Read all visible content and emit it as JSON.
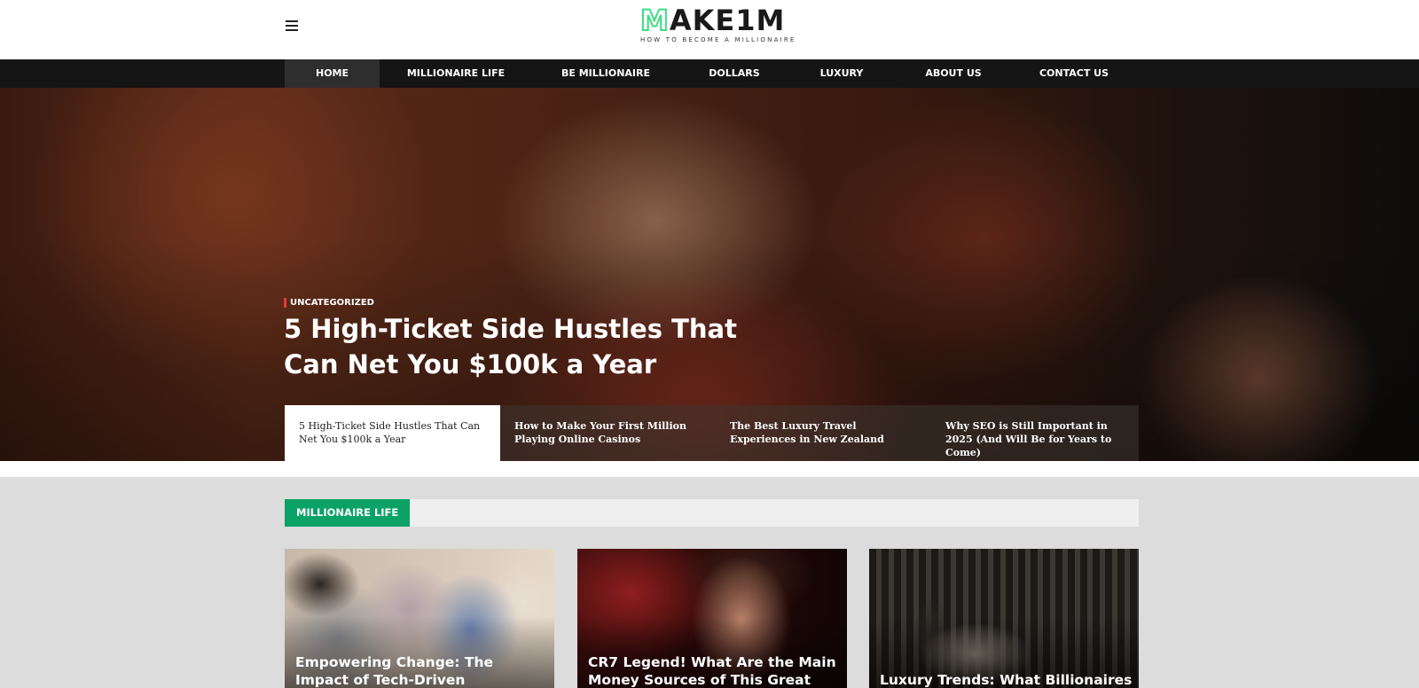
{
  "logo": {
    "m_letter": "M",
    "rest": "AKE1M",
    "tagline": "HOW TO BECOME A MILLIONAIRE"
  },
  "nav": {
    "items": [
      {
        "label": "HOME",
        "active": true
      },
      {
        "label": "MILLIONAIRE LIFE"
      },
      {
        "label": "BE MILLIONAIRE"
      },
      {
        "label": "DOLLARS"
      },
      {
        "label": "LUXURY"
      },
      {
        "label": "ABOUT US"
      },
      {
        "label": "CONTACT US"
      }
    ]
  },
  "hero": {
    "category": "UNCATEGORIZED",
    "title": "5 High-Ticket Side Hustles That Can Net You $100k a Year",
    "slides": [
      {
        "title": "5 High-Ticket Side Hustles That Can Net You $100k a Year",
        "active": true
      },
      {
        "title": "How to Make Your First Million Playing Online Casinos"
      },
      {
        "title": "The Best Luxury Travel Experiences in New Zealand"
      },
      {
        "title": "Why SEO is Still Important in 2025 (And Will Be for Years to Come)"
      }
    ]
  },
  "section": {
    "label": "MILLIONAIRE LIFE",
    "cards": [
      {
        "title": "Empowering Change: The Impact of Tech-Driven Philanthropy on"
      },
      {
        "title": "CR7 Legend! What Are the Main Money Sources of This Great"
      },
      {
        "title": "Luxury Trends: What Billionaires"
      }
    ]
  },
  "colors": {
    "accent_green": "#0aa266",
    "logo_green": "#3ddc84",
    "category_red": "#e53935",
    "nav_bg": "#151515"
  }
}
